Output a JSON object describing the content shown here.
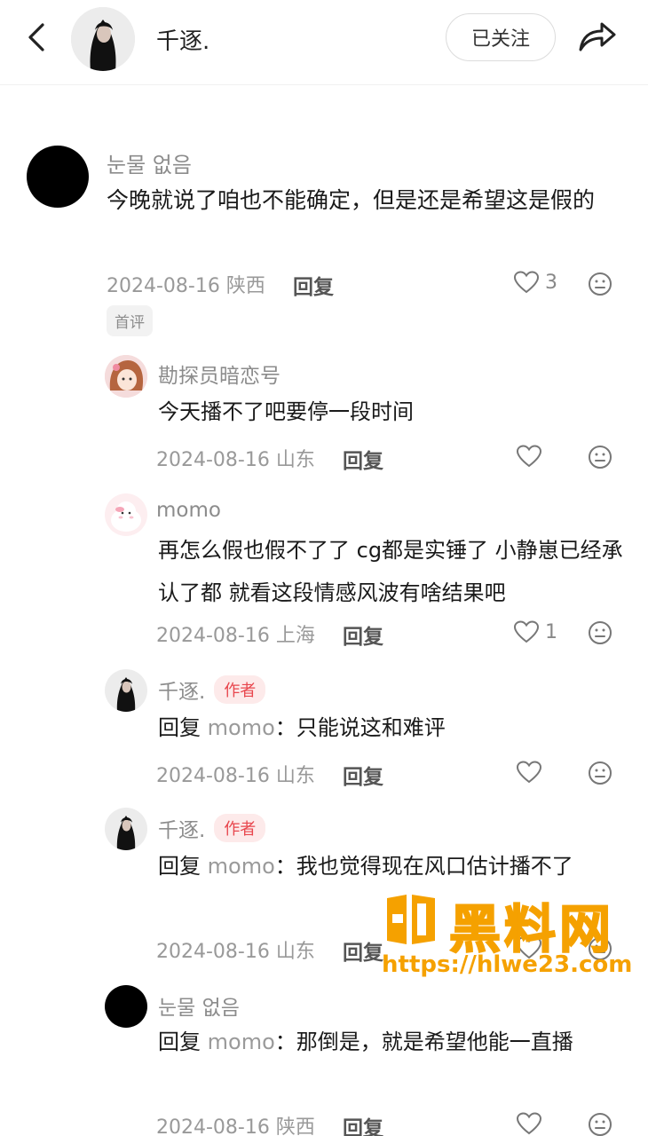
{
  "header": {
    "title": "千逐.",
    "follow_label": "已关注"
  },
  "icons": {
    "back": "chevron-left-icon",
    "share": "share-arrow-icon",
    "like": "heart-outline-icon",
    "dislike": "meh-face-icon"
  },
  "colors": {
    "author_badge_bg": "#fdeaea",
    "author_badge_text": "#e8464d",
    "watermark": "#f5a100"
  },
  "comments": [
    {
      "user": "눈물 없음",
      "text": "今晚就说了咱也不能确定，但是还是希望这是假的",
      "date": "2024-08-16",
      "location": "陕西",
      "reply_label": "回复",
      "likes": "3",
      "badge": "首评"
    }
  ],
  "replies": [
    {
      "user": "勘探员暗恋号",
      "text": "今天播不了吧要停一段时间",
      "date": "2024-08-16",
      "location": "山东",
      "reply_label": "回复",
      "likes": ""
    },
    {
      "user": "momo",
      "text": "再怎么假也假不了了 cg都是实锤了 小静崽已经承认了都 就看这段情感风波有啥结果吧",
      "date": "2024-08-16",
      "location": "上海",
      "reply_label": "回复",
      "likes": "1"
    },
    {
      "user": "千逐.",
      "author_badge": "作者",
      "reply_prefix": "回复",
      "reply_to": "momo",
      "text": "：只能说这和难评",
      "date": "2024-08-16",
      "location": "山东",
      "reply_label": "回复",
      "likes": ""
    },
    {
      "user": "千逐.",
      "author_badge": "作者",
      "reply_prefix": "回复",
      "reply_to": "momo",
      "text": "：我也觉得现在风口估计播不了",
      "date": "2024-08-16",
      "location": "山东",
      "reply_label": "回复",
      "likes": ""
    },
    {
      "user": "눈물 없음",
      "reply_prefix": "回复",
      "reply_to": "momo",
      "text": "：那倒是，就是希望他能一直播",
      "date": "2024-08-16",
      "location": "陕西",
      "reply_label": "回复",
      "likes": ""
    }
  ],
  "watermark": {
    "title": "黑料网",
    "url": "https://hlwe23.com"
  }
}
